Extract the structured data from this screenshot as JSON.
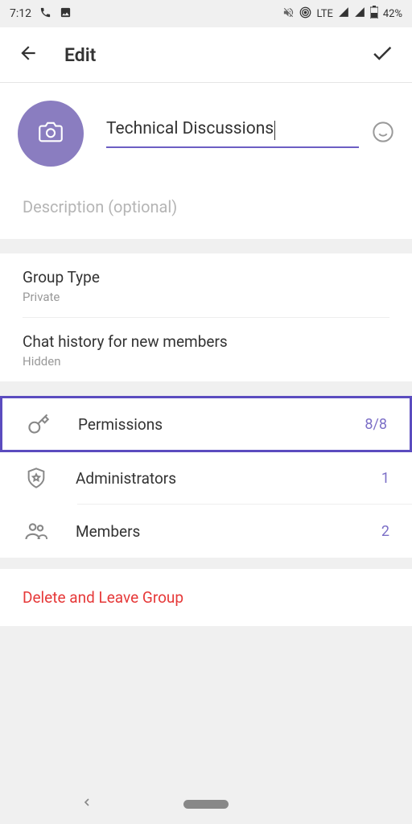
{
  "statusBar": {
    "time": "7:12",
    "network": "LTE",
    "battery": "42%"
  },
  "header": {
    "title": "Edit"
  },
  "group": {
    "name": "Technical Discussions",
    "descriptionPlaceholder": "Description (optional)"
  },
  "settings": {
    "groupType": {
      "label": "Group Type",
      "value": "Private"
    },
    "chatHistory": {
      "label": "Chat history for new members",
      "value": "Hidden"
    }
  },
  "rows": {
    "permissions": {
      "label": "Permissions",
      "value": "8/8"
    },
    "administrators": {
      "label": "Administrators",
      "value": "1"
    },
    "members": {
      "label": "Members",
      "value": "2"
    }
  },
  "delete": {
    "label": "Delete and Leave Group"
  }
}
